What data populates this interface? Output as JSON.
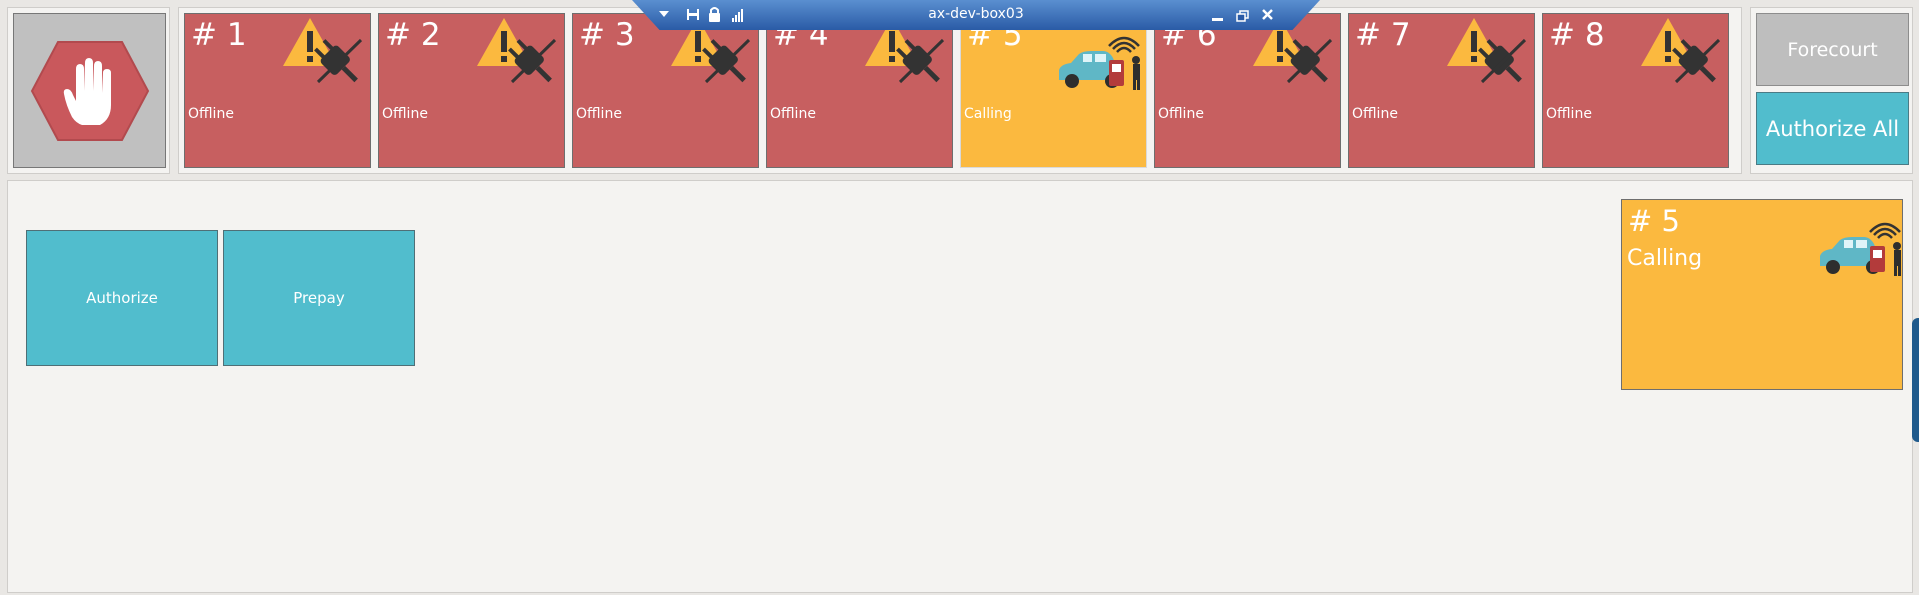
{
  "remote_bar": {
    "title": "ax-dev-box03",
    "icons": [
      "chevron-down-icon",
      "pin-icon",
      "lock-icon",
      "signal-icon",
      "minimize-icon",
      "restore-icon",
      "close-icon"
    ]
  },
  "stop_button": {
    "icon": "stop-hand-icon"
  },
  "pumps": [
    {
      "number": "# 1",
      "status": "Offline",
      "icon": "offline-warning-icon"
    },
    {
      "number": "# 2",
      "status": "Offline",
      "icon": "offline-warning-icon"
    },
    {
      "number": "# 3",
      "status": "Offline",
      "icon": "offline-warning-icon"
    },
    {
      "number": "# 4",
      "status": "Offline",
      "icon": "offline-warning-icon"
    },
    {
      "number": "# 5",
      "status": "Calling",
      "icon": "car-calling-icon"
    },
    {
      "number": "# 6",
      "status": "Offline",
      "icon": "offline-warning-icon"
    },
    {
      "number": "# 7",
      "status": "Offline",
      "icon": "offline-warning-icon"
    },
    {
      "number": "# 8",
      "status": "Offline",
      "icon": "offline-warning-icon"
    }
  ],
  "side_buttons": {
    "forecourt": "Forecourt",
    "authorize_all": "Authorize All"
  },
  "actions": {
    "authorize": "Authorize",
    "prepay": "Prepay"
  },
  "selected_pump": {
    "number": "# 5",
    "status": "Calling",
    "icon": "car-calling-icon"
  },
  "colors": {
    "offline": "#c75f60",
    "calling": "#fbb93f",
    "accent": "#51bdcd",
    "neutral": "#bebebe",
    "remote_bar": "#2a5ba6"
  }
}
